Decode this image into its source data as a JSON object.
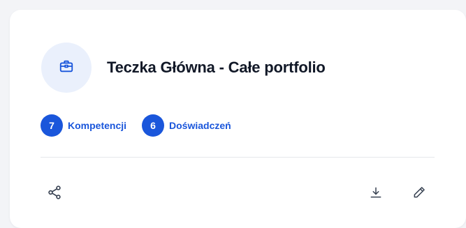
{
  "card": {
    "title": "Teczka Główna - Całe portfolio",
    "icon": "briefcase-icon",
    "accent_color": "#1a56db",
    "icon_bg_color": "#eaf0fc"
  },
  "badges": [
    {
      "count": "7",
      "label": "Kompetencji"
    },
    {
      "count": "6",
      "label": "Doświadczeń"
    }
  ],
  "actions": {
    "left": [
      "share-icon"
    ],
    "right": [
      "download-icon",
      "edit-icon"
    ]
  }
}
